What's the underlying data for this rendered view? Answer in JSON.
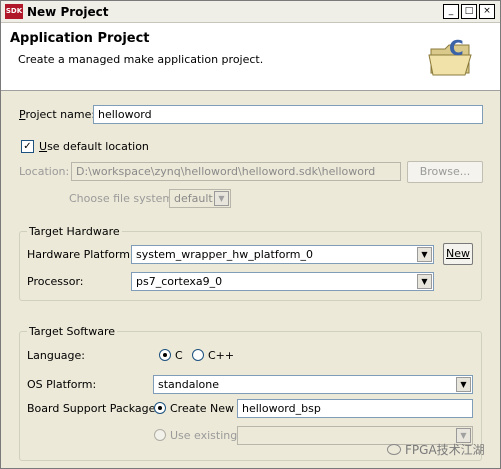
{
  "window": {
    "title": "New Project",
    "icon_text": "SDK",
    "controls": [
      "_",
      "□",
      "×"
    ]
  },
  "banner": {
    "title": "Application Project",
    "description": "Create a managed make application project.",
    "icon": "folder-c-icon"
  },
  "project": {
    "name_label_prefix": "",
    "name_label_mnemonic": "P",
    "name_label_rest": "roject name:",
    "name_value": "helloword",
    "use_default_label_mnemonic": "U",
    "use_default_label_rest": "se default location",
    "use_default_checked": true,
    "location_label": "Location:",
    "location_value": "D:\\workspace\\zynq\\helloword\\helloword.sdk\\helloword",
    "browse_label": "Browse...",
    "fs_label": "Choose file system:",
    "fs_value": "default"
  },
  "hardware": {
    "group_title": "Target Hardware",
    "platform_label": "Hardware Platform:",
    "platform_value": "system_wrapper_hw_platform_0",
    "new_button": "New",
    "processor_label": "Processor:",
    "processor_value": "ps7_cortexa9_0"
  },
  "software": {
    "group_title": "Target Software",
    "language_label": "Language:",
    "lang_c": "C",
    "lang_cpp": "C++",
    "lang_selected": "C",
    "os_label": "OS Platform:",
    "os_value": "standalone",
    "bsp_label": "Board Support Package:",
    "create_new_label": "Create New",
    "bsp_value": "helloword_bsp",
    "use_existing_label": "Use existing",
    "use_existing_value": ""
  },
  "watermark": "FPGA技术江湖"
}
